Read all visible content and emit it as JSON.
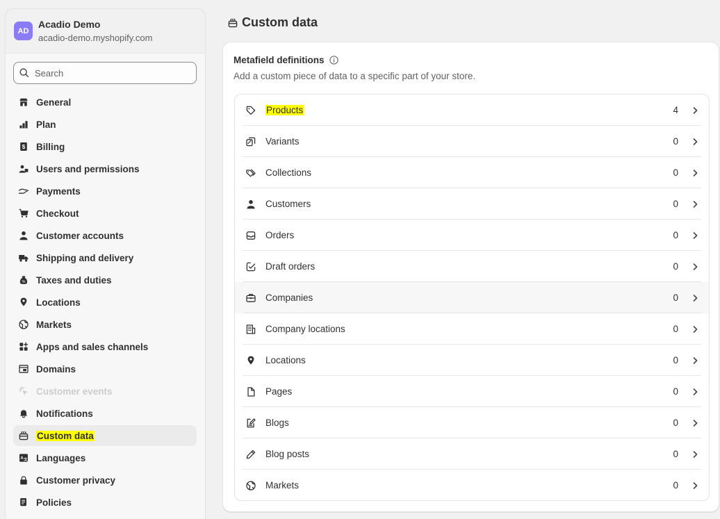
{
  "store": {
    "initials": "AD",
    "name": "Acadio Demo",
    "domain": "acadio-demo.myshopify.com"
  },
  "search": {
    "placeholder": "Search"
  },
  "sidebar": {
    "items": [
      {
        "label": "General",
        "icon": "store-icon"
      },
      {
        "label": "Plan",
        "icon": "plan-icon"
      },
      {
        "label": "Billing",
        "icon": "billing-icon"
      },
      {
        "label": "Users and permissions",
        "icon": "users-icon"
      },
      {
        "label": "Payments",
        "icon": "payments-icon"
      },
      {
        "label": "Checkout",
        "icon": "cart-icon"
      },
      {
        "label": "Customer accounts",
        "icon": "person-icon"
      },
      {
        "label": "Shipping and delivery",
        "icon": "truck-icon"
      },
      {
        "label": "Taxes and duties",
        "icon": "tax-icon"
      },
      {
        "label": "Locations",
        "icon": "location-pin-icon"
      },
      {
        "label": "Markets",
        "icon": "globe-icon"
      },
      {
        "label": "Apps and sales channels",
        "icon": "apps-icon"
      },
      {
        "label": "Domains",
        "icon": "domains-icon"
      },
      {
        "label": "Customer events",
        "icon": "cursor-icon",
        "disabled": true
      },
      {
        "label": "Notifications",
        "icon": "bell-icon"
      },
      {
        "label": "Custom data",
        "icon": "custom-data-icon",
        "active": true,
        "highlighted": true
      },
      {
        "label": "Languages",
        "icon": "language-icon"
      },
      {
        "label": "Customer privacy",
        "icon": "lock-icon"
      },
      {
        "label": "Policies",
        "icon": "policies-icon"
      }
    ]
  },
  "page": {
    "title": "Custom data"
  },
  "card": {
    "title": "Metafield definitions",
    "subtitle": "Add a custom piece of data to a specific part of your store.",
    "rows": [
      {
        "label": "Products",
        "count": "4",
        "icon": "tag-icon",
        "highlighted": true
      },
      {
        "label": "Variants",
        "count": "0",
        "icon": "variants-icon"
      },
      {
        "label": "Collections",
        "count": "0",
        "icon": "collections-icon"
      },
      {
        "label": "Customers",
        "count": "0",
        "icon": "person-icon"
      },
      {
        "label": "Orders",
        "count": "0",
        "icon": "inbox-icon"
      },
      {
        "label": "Draft orders",
        "count": "0",
        "icon": "draft-order-icon"
      },
      {
        "label": "Companies",
        "count": "0",
        "icon": "briefcase-icon",
        "hover": true
      },
      {
        "label": "Company locations",
        "count": "0",
        "icon": "building-icon"
      },
      {
        "label": "Locations",
        "count": "0",
        "icon": "location-pin-icon"
      },
      {
        "label": "Pages",
        "count": "0",
        "icon": "page-icon"
      },
      {
        "label": "Blogs",
        "count": "0",
        "icon": "blog-icon"
      },
      {
        "label": "Blog posts",
        "count": "0",
        "icon": "pencil-icon"
      },
      {
        "label": "Markets",
        "count": "0",
        "icon": "globe-icon"
      }
    ]
  },
  "colors": {
    "highlight": "#ffff00",
    "avatar": "#8b7bf5",
    "text": "#303030",
    "muted": "#616161"
  }
}
